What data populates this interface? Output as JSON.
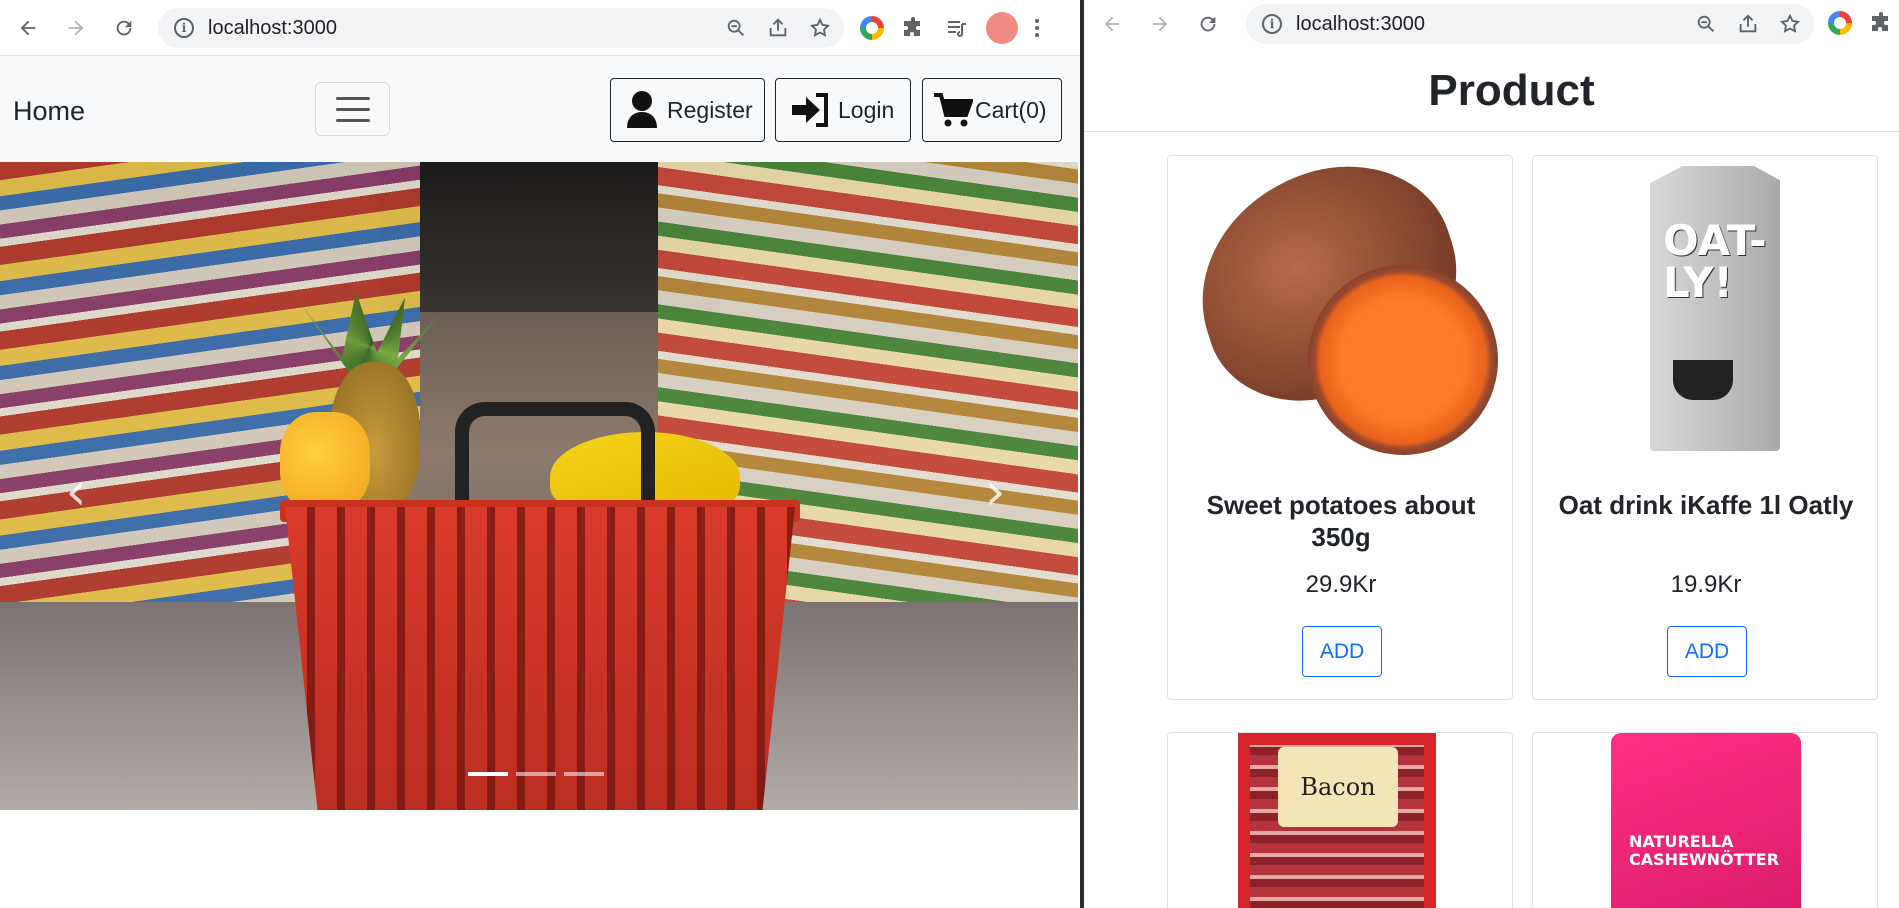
{
  "left_window": {
    "browser": {
      "url": "localhost:3000"
    },
    "navbar": {
      "home_label": "Home",
      "register_label": "Register",
      "login_label": "Login",
      "cart_label": "Cart(0)"
    },
    "carousel": {
      "slide_count": 3,
      "active_slide": 1,
      "prev_icon": "chevron-left-icon",
      "next_icon": "chevron-right-icon"
    }
  },
  "right_window": {
    "browser": {
      "url": "localhost:3000"
    },
    "heading": "Product",
    "products": [
      {
        "name": "Sweet potatoes about 350g",
        "price": "29.9Kr",
        "add_label": "ADD"
      },
      {
        "name": "Oat drink iKaffe 1l Oatly",
        "price": "19.9Kr",
        "add_label": "ADD"
      },
      {
        "name": "",
        "price": "",
        "add_label": ""
      },
      {
        "name": "",
        "price": "",
        "add_label": ""
      }
    ],
    "package_text": {
      "oatly": "OAT-LY!",
      "bacon": "Bacon",
      "cashew": "NATURELLA CASHEWNÖTTER"
    }
  },
  "colors": {
    "primary": "#0d6efd",
    "navbar_bg": "#f8f9fa",
    "text": "#212529"
  }
}
